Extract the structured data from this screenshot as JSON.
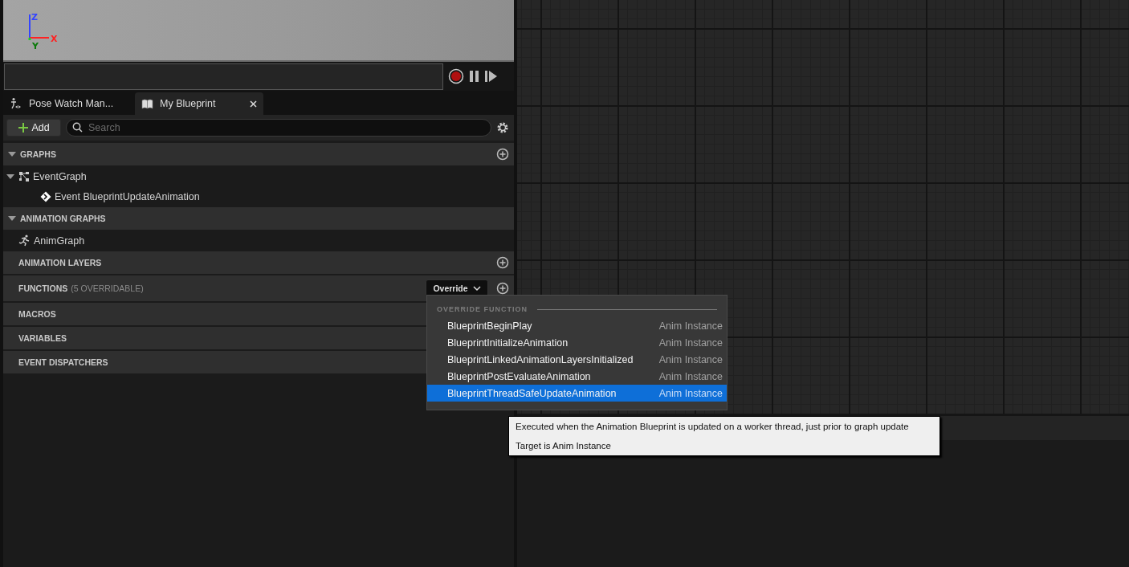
{
  "viewport": {
    "axis_labels": [
      {
        "label": "Z",
        "color": "#3344ff"
      },
      {
        "label": "X",
        "color": "#ff2222"
      },
      {
        "label": "Y",
        "color": "#0a7a0a"
      }
    ]
  },
  "tabs": [
    {
      "label": "Pose Watch Man...",
      "selected": false,
      "kind": "pose",
      "closable": false
    },
    {
      "label": "My Blueprint",
      "selected": true,
      "kind": "book",
      "closable": true
    }
  ],
  "toolbar": {
    "add_label": "Add",
    "search": {
      "placeholder": "Search"
    }
  },
  "sections": [
    {
      "title": "GRAPHS",
      "kind": "tree",
      "expanded": true,
      "addable": true,
      "items": [
        {
          "label": "EventGraph",
          "kind": "graph",
          "expanded": true,
          "children": [
            {
              "label": "Event BlueprintUpdateAnimation",
              "kind": "event"
            }
          ]
        }
      ]
    },
    {
      "title": "ANIMATION GRAPHS",
      "kind": "tree",
      "expanded": true,
      "addable": false,
      "items": [
        {
          "label": "AnimGraph",
          "kind": "anim"
        }
      ]
    },
    {
      "title": "ANIMATION LAYERS",
      "kind": "plain",
      "addable": true
    },
    {
      "title": "FUNCTIONS",
      "note": "(5 OVERRIDABLE)",
      "kind": "plain",
      "addable": true,
      "override_label": "Override"
    },
    {
      "title": "MACROS",
      "kind": "plain",
      "addable": false
    },
    {
      "title": "VARIABLES",
      "kind": "plain",
      "addable": false
    },
    {
      "title": "EVENT DISPATCHERS",
      "kind": "plain",
      "addable": false
    }
  ],
  "override_menu": {
    "heading": "OVERRIDE FUNCTION",
    "items": [
      {
        "name": "BlueprintBeginPlay",
        "owner": "Anim Instance",
        "selected": false
      },
      {
        "name": "BlueprintInitializeAnimation",
        "owner": "Anim Instance",
        "selected": false
      },
      {
        "name": "BlueprintLinkedAnimationLayersInitialized",
        "owner": "Anim Instance",
        "selected": false
      },
      {
        "name": "BlueprintPostEvaluateAnimation",
        "owner": "Anim Instance",
        "selected": false
      },
      {
        "name": "BlueprintThreadSafeUpdateAnimation",
        "owner": "Anim Instance",
        "selected": true
      }
    ]
  },
  "tooltip": {
    "lines": [
      "Executed when the Animation Blueprint is updated on a worker thread, just prior to graph update",
      "Target is Anim Instance"
    ]
  }
}
